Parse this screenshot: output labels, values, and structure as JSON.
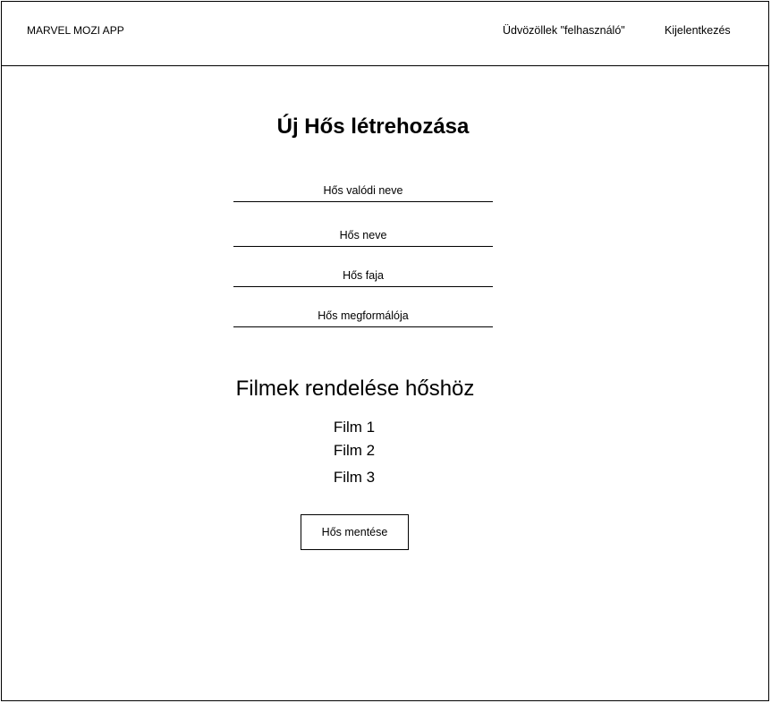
{
  "header": {
    "app_title": "MARVEL MOZI APP",
    "welcome_text": "Üdvözöllek \"felhasználó\"",
    "logout_label": "Kijelentkezés"
  },
  "form": {
    "title": "Új Hős létrehozása",
    "fields": [
      {
        "placeholder": "Hős valódi neve"
      },
      {
        "placeholder": "Hős neve"
      },
      {
        "placeholder": "Hős faja"
      },
      {
        "placeholder": "Hős megformálója"
      }
    ]
  },
  "films": {
    "title": "Filmek rendelése hőshöz",
    "items": [
      "Film 1",
      "Film 2",
      "Film 3"
    ]
  },
  "actions": {
    "save_label": "Hős mentése"
  }
}
